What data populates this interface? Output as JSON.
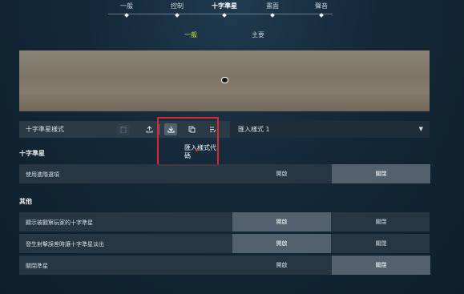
{
  "top_nav": {
    "items": [
      "一般",
      "控制",
      "十字準星",
      "畫面",
      "聲音"
    ],
    "active_index": 2
  },
  "sub_tabs": {
    "items": [
      "一般",
      "主要"
    ],
    "active_index": 0
  },
  "toolbar": {
    "style_label": "十字準星樣式",
    "delete_icon": "trash-icon",
    "export_icon": "upload-icon",
    "import_icon": "download-icon",
    "copy_icon": "copy-icon",
    "rename_icon": "edit-list-icon",
    "select_value": "匯入樣式 1"
  },
  "tooltip": {
    "text": "匯入樣式代碼"
  },
  "sections": {
    "crosshair": {
      "title": "十字準星",
      "rows": [
        {
          "label": "使用進階選項",
          "on": "開啟",
          "off": "關閉",
          "selected": "off"
        }
      ]
    },
    "other": {
      "title": "其他",
      "rows": [
        {
          "label": "顯示被觀察玩家的十字準星",
          "on": "開啟",
          "off": "關閉",
          "selected": "on"
        },
        {
          "label": "發生射擊誤差時讓十字準星淡出",
          "on": "開啟",
          "off": "關閉",
          "selected": "on"
        },
        {
          "label": "關閉準星",
          "on": "開啟",
          "off": "關閉",
          "selected": "off"
        }
      ]
    }
  },
  "colors": {
    "accent": "#c7e83a",
    "highlight": "#e0262c"
  }
}
